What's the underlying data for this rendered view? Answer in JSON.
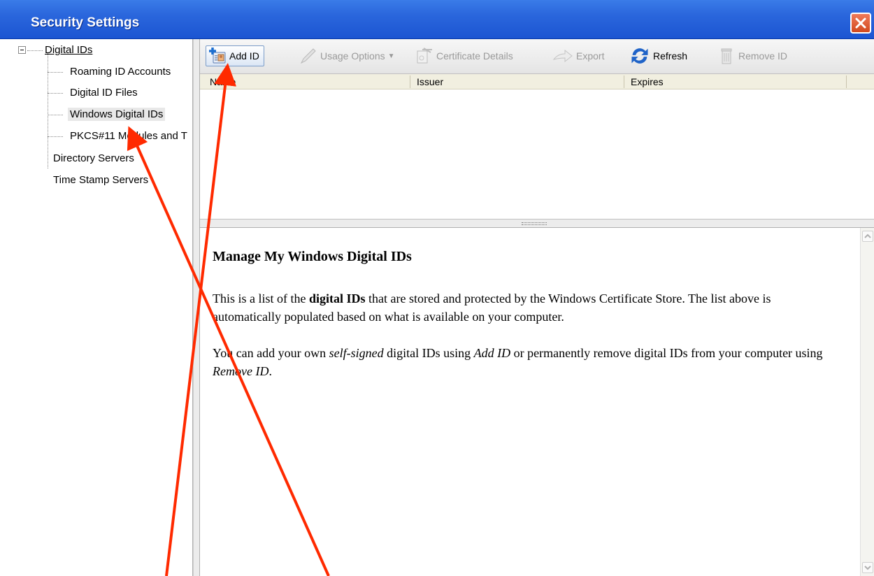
{
  "window": {
    "title": "Security Settings"
  },
  "tree": {
    "root_label": "Digital IDs",
    "children": [
      "Roaming ID Accounts",
      "Digital ID Files",
      "Windows Digital IDs",
      "PKCS#11 Modules and T"
    ],
    "siblings": [
      "Directory Servers",
      "Time Stamp Servers"
    ],
    "selected": "Windows Digital IDs"
  },
  "toolbar": {
    "add_id": "Add ID",
    "usage_options": "Usage Options",
    "certificate_details": "Certificate Details",
    "export": "Export",
    "refresh": "Refresh",
    "remove_id": "Remove ID"
  },
  "list": {
    "columns": [
      "Name",
      "Issuer",
      "Expires"
    ]
  },
  "description": {
    "heading": "Manage My Windows Digital IDs",
    "p1_a": "This is a list of the ",
    "p1_bold": "digital IDs",
    "p1_b": " that are stored and protected by the Windows Certificate Store. The list above is automatically populated based on what is available on your computer.",
    "p2_a": "You can add your own ",
    "p2_i1": "self-signed",
    "p2_b": " digital IDs using ",
    "p2_i2": "Add ID",
    "p2_c": " or permanently remove digital IDs from your computer using ",
    "p2_i3": "Remove ID",
    "p2_d": "."
  },
  "colors": {
    "titlebar": "#2a66dc",
    "annotation": "#ff2a00"
  }
}
